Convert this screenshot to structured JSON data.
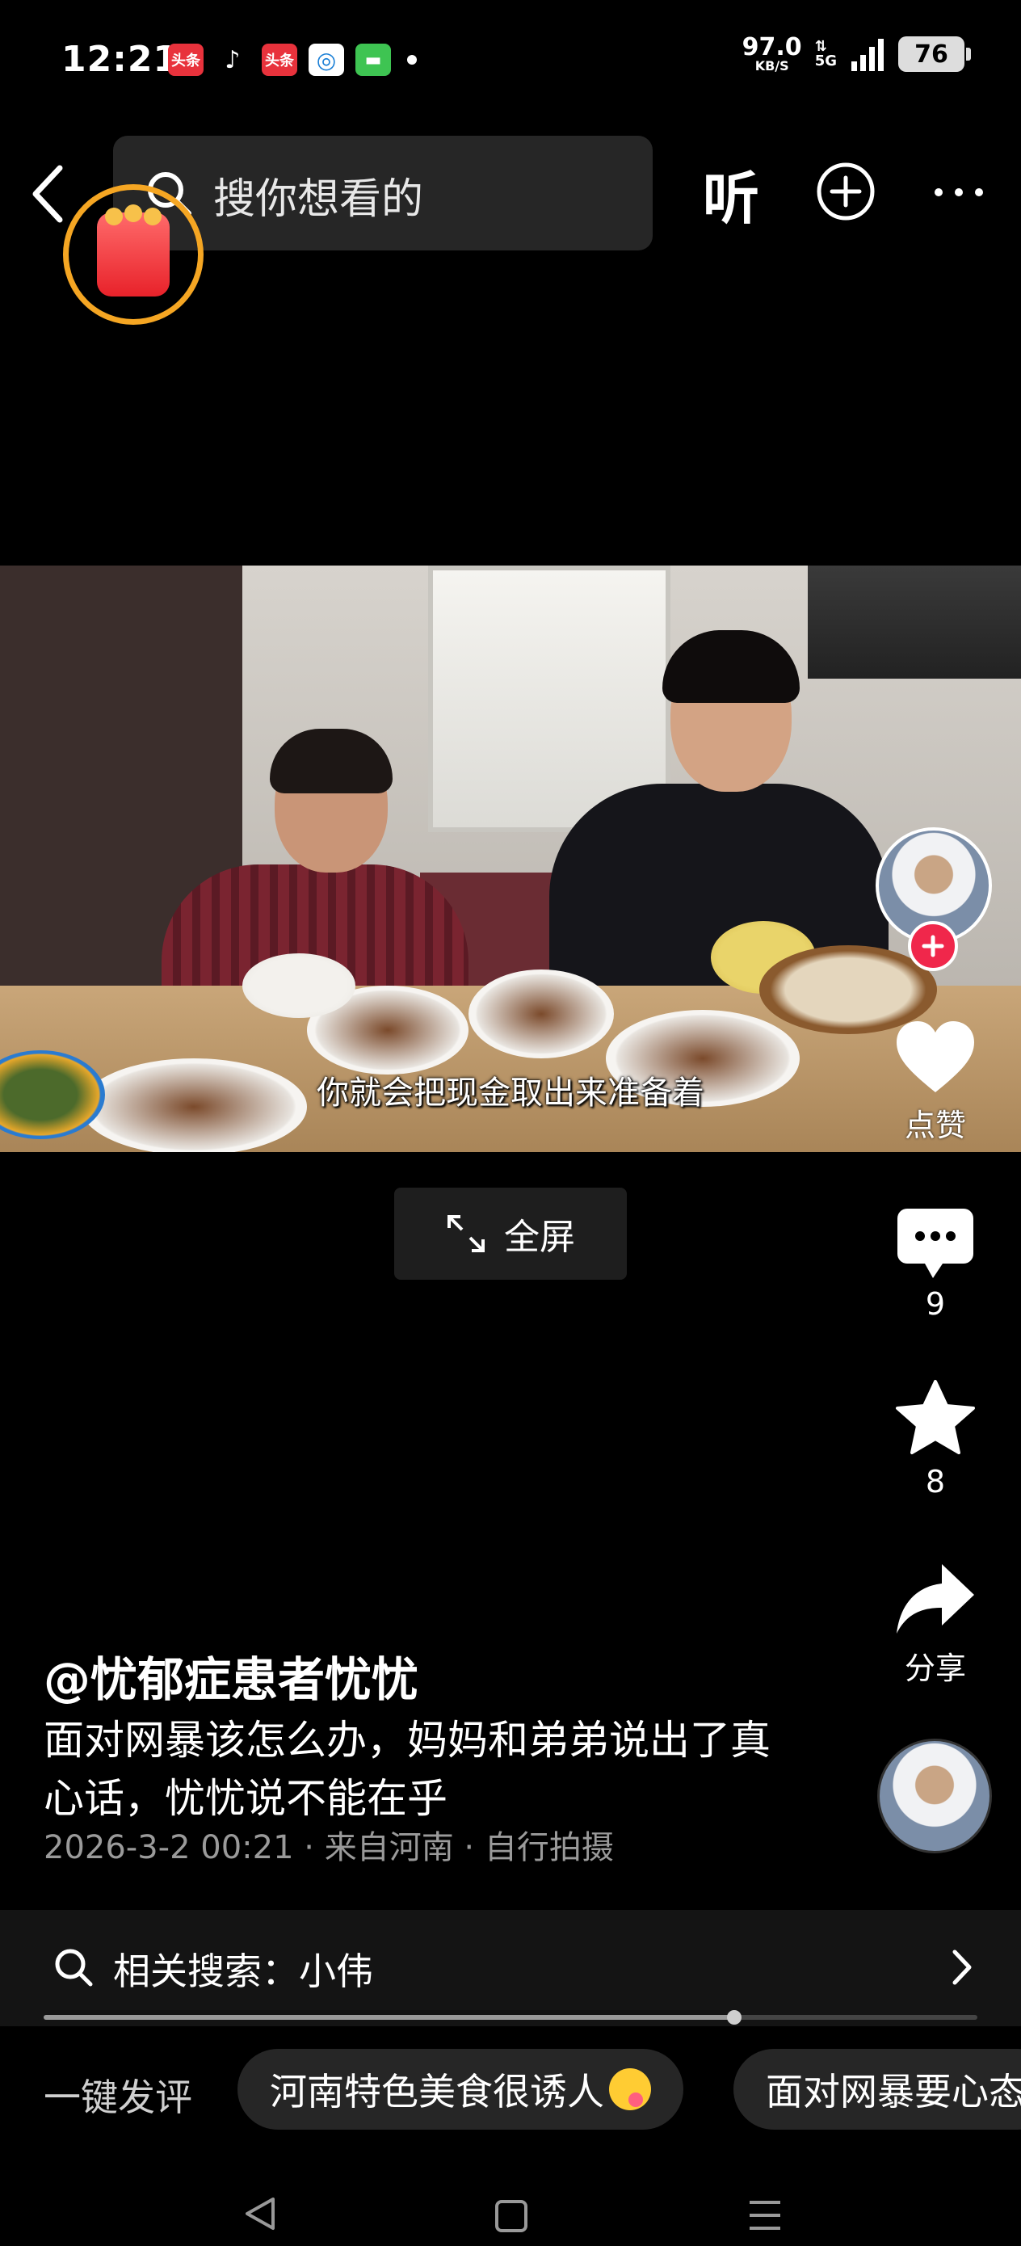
{
  "status_bar": {
    "time": "12:21",
    "app_icons": [
      {
        "name": "toutiao-icon",
        "label": "头条",
        "color": "#e8323c"
      },
      {
        "name": "tiktok-icon",
        "label": "♪",
        "color": "#000000"
      },
      {
        "name": "toutiao-lite-icon",
        "label": "头条",
        "color": "#e8323c"
      },
      {
        "name": "china-mobile-icon",
        "label": "◎",
        "color": "#ffffff"
      },
      {
        "name": "message-icon",
        "label": "▬",
        "color": "#3ec452"
      }
    ],
    "net_speed_value": "97.0",
    "net_speed_unit": "KB/S",
    "network": "5G",
    "battery": "76"
  },
  "top_bar": {
    "search_placeholder": "搜你想看的",
    "listen_label": "听"
  },
  "video": {
    "subtitle": "你就会把现金取出来准备着"
  },
  "actions": {
    "like_label": "点赞",
    "comment_count": "9",
    "favorite_count": "8",
    "share_label": "分享"
  },
  "fullscreen_label": "全屏",
  "post": {
    "author": "@忧郁症患者忧忧",
    "description": "面对网暴该怎么办，妈妈和弟弟说出了真心话，忧忧说不能在乎",
    "meta": "2026-3-2 00:21 · 来自河南 · 自行拍摄"
  },
  "related_search": {
    "label": "相关搜索：小伟"
  },
  "progress": 0.74,
  "quick_comment": {
    "label": "一键发评",
    "chips": [
      "河南特色美食很诱人",
      "面对网暴要心态"
    ]
  },
  "colors": {
    "accent_red": "#f0274b",
    "red_packet_ring": "#f5a623"
  }
}
